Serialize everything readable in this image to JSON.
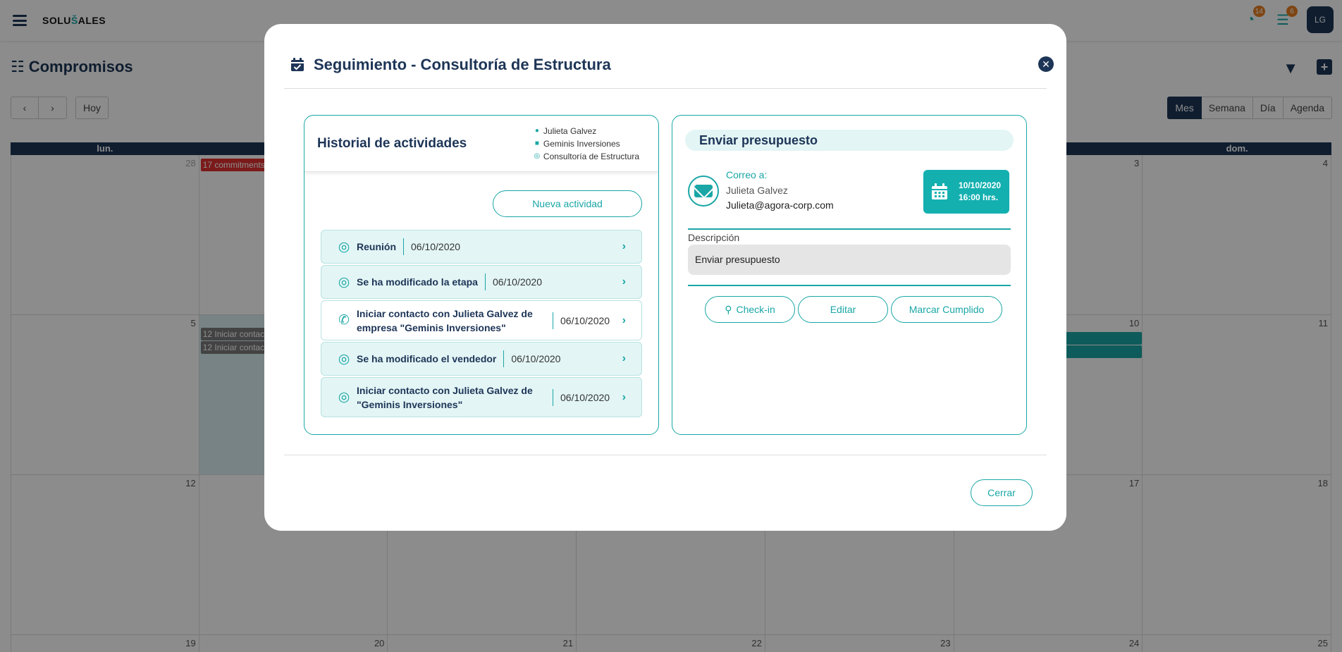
{
  "app": {
    "logo_pre": "SOLU",
    "logo_mid": "Š",
    "logo_post": "ALES",
    "badge_activity": "14",
    "badge_tasks": "6",
    "avatar": "LG",
    "page_title": "Compromisos",
    "today_label": "Hoy",
    "views": [
      "Mes",
      "Semana",
      "Día",
      "Agenda"
    ],
    "weekdays": [
      "lun.",
      "",
      "",
      "",
      "",
      "",
      "dom."
    ],
    "week1": [
      "28",
      "",
      "",
      "",
      "",
      "3",
      "4"
    ],
    "week2": [
      "5",
      "",
      "",
      "",
      "",
      "10",
      "11"
    ],
    "week3": [
      "12",
      "",
      "",
      "",
      "",
      "17",
      "18"
    ],
    "week4": [
      "19",
      "20",
      "21",
      "22",
      "23",
      "24",
      "25"
    ],
    "events": {
      "e1": "17 commitments",
      "e2": "12 Iniciar contacto",
      "e3": "12 Iniciar contacto"
    }
  },
  "modal": {
    "title": "Seguimiento - Consultoría de Estructura",
    "history": {
      "title": "Historial de actividades",
      "meta_contact": "Julieta Galvez",
      "meta_company": "Geminis Inversiones",
      "meta_deal": "Consultoría de Estructura",
      "new_activity": "Nueva actividad",
      "items": [
        {
          "label": "Reunión",
          "date": "06/10/2020"
        },
        {
          "label": "Se ha modificado la etapa",
          "date": "06/10/2020"
        },
        {
          "label": "Iniciar contacto con Julieta Galvez de empresa \"Geminis Inversiones\"",
          "date": "06/10/2020"
        },
        {
          "label": "Se ha modificado el vendedor",
          "date": "06/10/2020"
        },
        {
          "label": "Iniciar contacto con Julieta Galvez de \"Geminis Inversiones\"",
          "date": "06/10/2020"
        }
      ]
    },
    "detail": {
      "title": "Enviar presupuesto",
      "to_label": "Correo a:",
      "to_name": "Julieta Galvez",
      "to_email": "Julieta@agora-corp.com",
      "date": "10/10/2020",
      "time": "16:00 hrs.",
      "desc_label": "Descripción",
      "desc_value": "Enviar presupuesto",
      "checkin": "Check-in",
      "edit": "Editar",
      "done": "Marcar Cumplido"
    },
    "close": "Cerrar"
  },
  "colors": {
    "accent": "#1aa6a6",
    "navy": "#1d3557"
  }
}
